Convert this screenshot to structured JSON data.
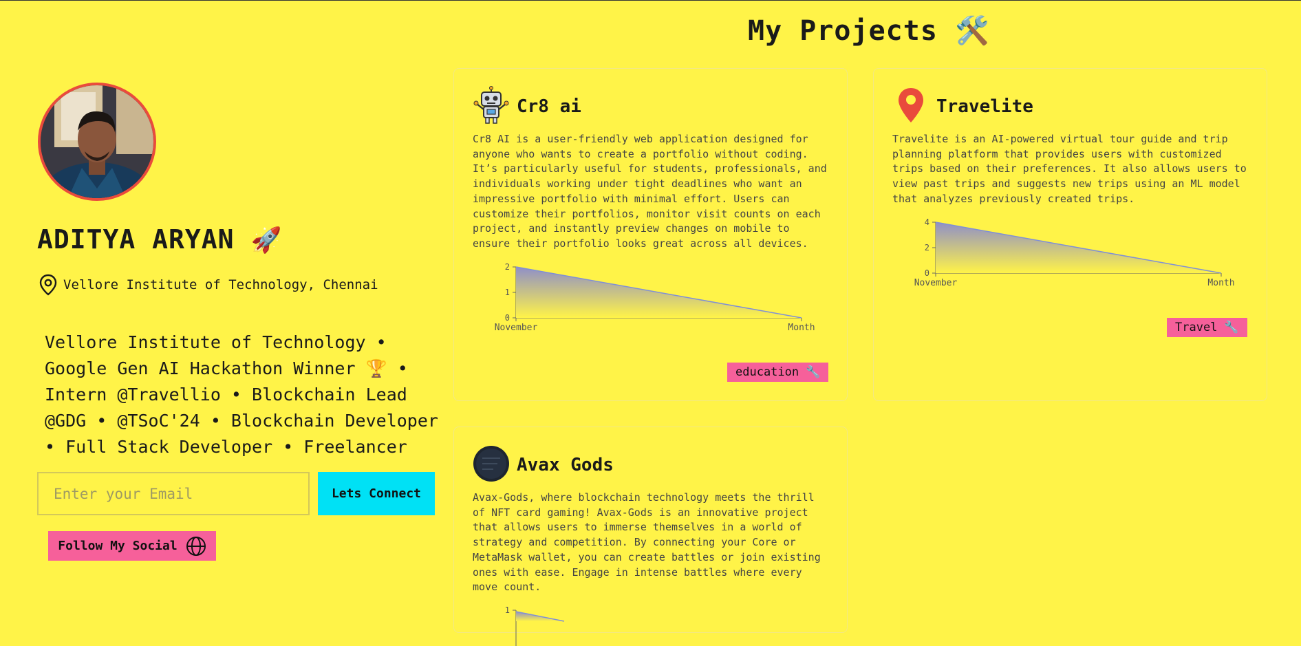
{
  "page": {
    "title": "My Projects",
    "title_emoji": "🛠️"
  },
  "profile": {
    "name": "ADITYA ARYAN",
    "name_emoji": "🚀",
    "location": "Vellore Institute of Technology, Chennai",
    "bio": "Vellore Institute of Technology • Google Gen AI Hackathon Winner 🏆 • Intern @Travellio • Blockchain Lead @GDG • @TSoC'24 • Blockchain Developer • Full Stack Developer • Freelancer",
    "email_placeholder": "Enter your Email",
    "connect_label": "Lets Connect",
    "social_label": "Follow My Social"
  },
  "projects": [
    {
      "title": "Cr8 ai",
      "icon": "robot-icon",
      "description": "Cr8 AI is a user-friendly web application designed for anyone who wants to create a portfolio without coding. It’s particularly useful for students, professionals, and individuals working under tight deadlines who want an impressive portfolio with minimal effort. Users can customize their portfolios, monitor visit counts on each project, and instantly preview changes on mobile to ensure their portfolio looks great across all devices.",
      "tag": "education",
      "chart_data": {
        "type": "area",
        "x": [
          "November",
          "Month"
        ],
        "values": [
          2,
          0
        ],
        "ylim": [
          0,
          2
        ],
        "yticks": [
          "0",
          "1",
          "2"
        ]
      }
    },
    {
      "title": "Travelite",
      "icon": "map-pin-icon",
      "description": "Travelite is an AI-powered virtual tour guide and trip planning platform that provides users with customized trips based on their preferences. It also allows users to view past trips and suggests new trips using an ML model that analyzes previously created trips.",
      "tag": "Travel",
      "chart_data": {
        "type": "area",
        "x": [
          "November",
          "Month"
        ],
        "values": [
          4,
          0
        ],
        "ylim": [
          0,
          4
        ],
        "yticks": [
          "0",
          "2",
          "4"
        ]
      }
    },
    {
      "title": "Avax Gods",
      "icon": "avax-logo-icon",
      "description": "Avax-Gods, where blockchain technology meets the thrill of NFT card gaming! Avax-Gods is an innovative project that allows users to immerse themselves in a world of strategy and competition. By connecting your Core or MetaMask wallet, you can create battles or join existing ones with ease. Engage in intense battles where every move count.",
      "chart_data": {
        "type": "area",
        "yticks": [
          "1"
        ]
      }
    }
  ],
  "colors": {
    "background": "#fff348",
    "accent_pink": "#f6609a",
    "accent_cyan": "#00e1f5",
    "chart_line": "#7f8fd6"
  }
}
